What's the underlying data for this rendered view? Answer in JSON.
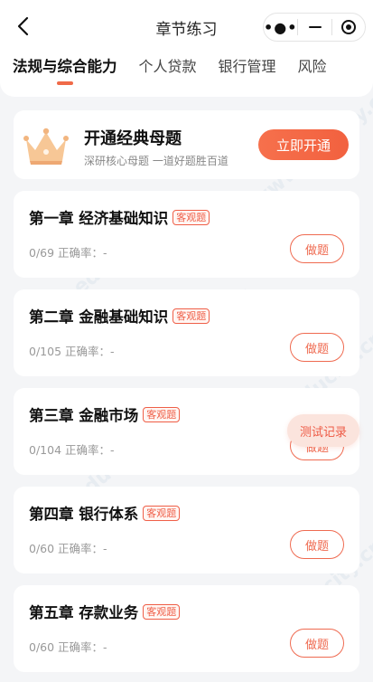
{
  "header": {
    "title": "章节练习",
    "tabs": [
      {
        "label": "法规与综合能力",
        "active": true
      },
      {
        "label": "个人贷款",
        "active": false
      },
      {
        "label": "银行管理",
        "active": false
      },
      {
        "label": "风险",
        "active": false
      }
    ]
  },
  "promo": {
    "title": "开通经典母题",
    "subtitle": "深研核心母题 一道好题胜百道",
    "button": "立即开通"
  },
  "chapters": [
    {
      "name": "第一章 经济基础知识",
      "badge": "客观题",
      "stat": "0/69 正确率：-",
      "button": "做题"
    },
    {
      "name": "第二章 金融基础知识",
      "badge": "客观题",
      "stat": "0/105 正确率：-",
      "button": "做题"
    },
    {
      "name": "第三章 金融市场",
      "badge": "客观题",
      "stat": "0/104 正确率：-",
      "button": "做题"
    },
    {
      "name": "第四章 银行体系",
      "badge": "客观题",
      "stat": "0/60 正确率：-",
      "button": "做题"
    },
    {
      "name": "第五章 存款业务",
      "badge": "客观题",
      "stat": "0/60 正确率：-",
      "button": "做题"
    }
  ],
  "floating": {
    "label": "测试记录"
  },
  "watermark": {
    "brand": "希赛网",
    "url": "www.educity.cn"
  },
  "colors": {
    "accent": "#f06a48",
    "background": "#f4f5f7"
  }
}
